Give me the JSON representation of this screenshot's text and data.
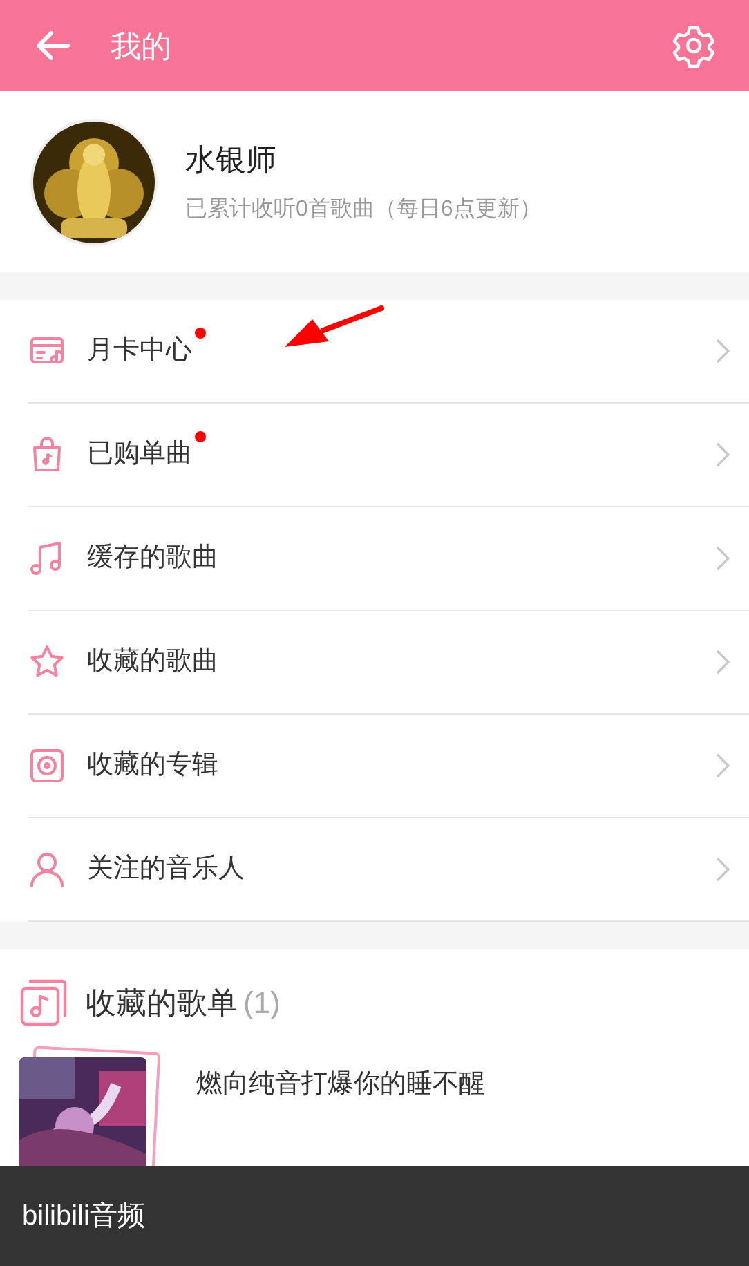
{
  "header": {
    "title": "我的"
  },
  "profile": {
    "name": "水银师",
    "subtitle": "已累计收听0首歌曲（每日6点更新）"
  },
  "menu": [
    {
      "kind": "card",
      "label": "月卡中心",
      "dot": true
    },
    {
      "kind": "bag",
      "label": "已购单曲",
      "dot": true
    },
    {
      "kind": "note",
      "label": "缓存的歌曲",
      "dot": false
    },
    {
      "kind": "star",
      "label": "收藏的歌曲",
      "dot": false
    },
    {
      "kind": "disc",
      "label": "收藏的专辑",
      "dot": false
    },
    {
      "kind": "person",
      "label": "关注的音乐人",
      "dot": false
    }
  ],
  "playlists": {
    "title": "收藏的歌单",
    "count": "(1)",
    "items": [
      {
        "name": "燃向纯音打爆你的睡不醒"
      }
    ]
  },
  "bottom_bar": {
    "label": "bilibili音频"
  }
}
